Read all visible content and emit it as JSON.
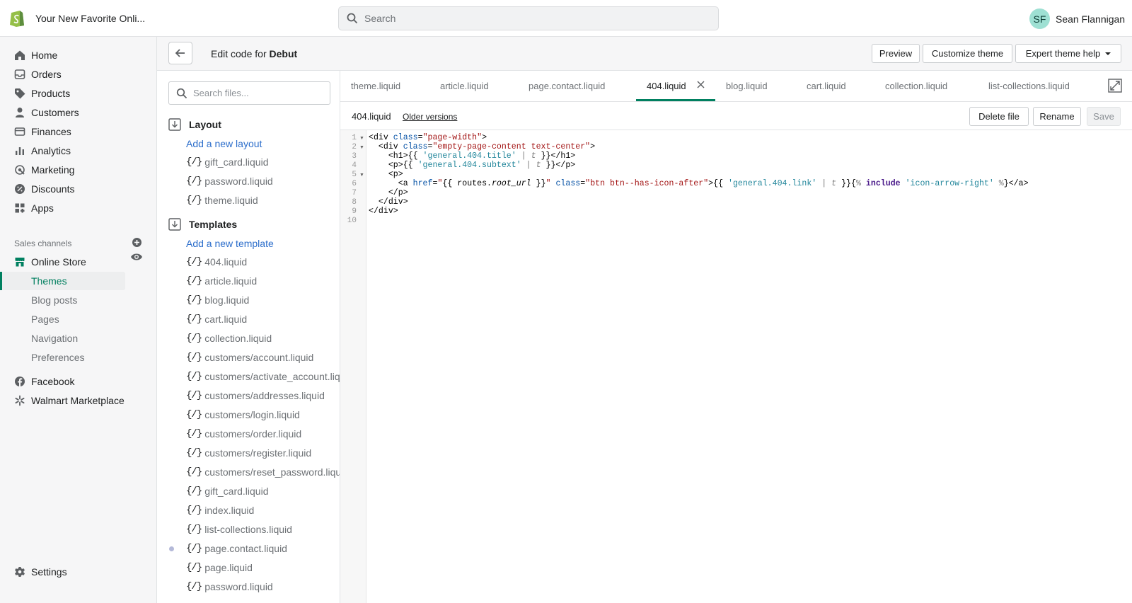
{
  "store": {
    "name": "Your New Favorite Onli..."
  },
  "search": {
    "placeholder": "Search"
  },
  "user": {
    "initials": "SF",
    "name": "Sean Flannigan"
  },
  "nav": {
    "items": [
      {
        "label": "Home",
        "icon": "home-icon"
      },
      {
        "label": "Orders",
        "icon": "orders-icon"
      },
      {
        "label": "Products",
        "icon": "tag-icon"
      },
      {
        "label": "Customers",
        "icon": "person-icon"
      },
      {
        "label": "Finances",
        "icon": "finances-icon"
      },
      {
        "label": "Analytics",
        "icon": "analytics-icon"
      },
      {
        "label": "Marketing",
        "icon": "marketing-icon"
      },
      {
        "label": "Discounts",
        "icon": "discount-icon"
      },
      {
        "label": "Apps",
        "icon": "apps-icon"
      }
    ],
    "sales_channels_label": "Sales channels",
    "online_store": "Online Store",
    "online_store_sub": [
      "Themes",
      "Blog posts",
      "Pages",
      "Navigation",
      "Preferences"
    ],
    "channels": [
      "Facebook",
      "Walmart Marketplace"
    ],
    "settings": "Settings"
  },
  "header": {
    "title_prefix": "Edit code for ",
    "title_theme": "Debut",
    "preview": "Preview",
    "customize": "Customize theme",
    "expert_help": "Expert theme help"
  },
  "tree": {
    "search_placeholder": "Search files...",
    "layout": {
      "heading": "Layout",
      "add": "Add a new layout",
      "files": [
        "gift_card.liquid",
        "password.liquid",
        "theme.liquid"
      ]
    },
    "templates": {
      "heading": "Templates",
      "add": "Add a new template",
      "files": [
        "404.liquid",
        "article.liquid",
        "blog.liquid",
        "cart.liquid",
        "collection.liquid",
        "customers/account.liquid",
        "customers/activate_account.liquid",
        "customers/addresses.liquid",
        "customers/login.liquid",
        "customers/order.liquid",
        "customers/register.liquid",
        "customers/reset_password.liquid",
        "gift_card.liquid",
        "index.liquid",
        "list-collections.liquid",
        "page.contact.liquid",
        "page.liquid",
        "password.liquid"
      ]
    },
    "glyph": "{/}"
  },
  "editor": {
    "tabs": [
      "theme.liquid",
      "article.liquid",
      "page.contact.liquid",
      "404.liquid",
      "blog.liquid",
      "cart.liquid",
      "collection.liquid",
      "list-collections.liquid"
    ],
    "active_tab": "404.liquid",
    "file_name": "404.liquid",
    "older_versions": "Older versions",
    "delete": "Delete file",
    "rename": "Rename",
    "save": "Save",
    "line_numbers": [
      "1",
      "2",
      "3",
      "4",
      "5",
      "6",
      "7",
      "8",
      "9",
      "10"
    ]
  }
}
